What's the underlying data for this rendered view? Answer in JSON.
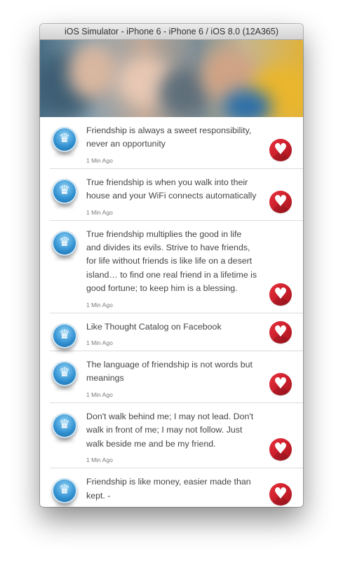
{
  "window": {
    "title": "iOS Simulator - iPhone 6 - iPhone 6 / iOS 8.0 (12A365)"
  },
  "header": {
    "image": "blurred-group-photo"
  },
  "feed": {
    "items": [
      {
        "text": "Friendship is always a sweet responsibility, never an opportunity",
        "time": "1 Min Ago"
      },
      {
        "text": "True friendship is when you walk into their house and your WiFi connects automatically",
        "time": "1 Min Ago"
      },
      {
        "text": "True friendship multiplies the good in life and divides its evils. Strive to have friends, for life without friends is like life on a desert island… to find one real friend in a lifetime is good fortune; to keep him is a blessing.",
        "time": "1 Min Ago"
      },
      {
        "text": "Like Thought Catalog on Facebook",
        "time": "1 Min Ago"
      },
      {
        "text": "The language of friendship is not words but meanings",
        "time": "1 Min Ago"
      },
      {
        "text": "Don't walk behind me; I may not lead. Don't walk in front of me; I may not follow. Just walk beside me and be my friend.",
        "time": "1 Min Ago"
      },
      {
        "text": "Friendship is like money, easier made than kept. -",
        "time": ""
      }
    ]
  },
  "icons": {
    "avatar": "crown-avatar-icon",
    "like": "heart-icon"
  },
  "colors": {
    "like_button": "#d8232f",
    "avatar_blue": "#2f8fd0",
    "text": "#444444",
    "timestamp": "#7a7a7a",
    "divider": "#dcdcdc"
  }
}
